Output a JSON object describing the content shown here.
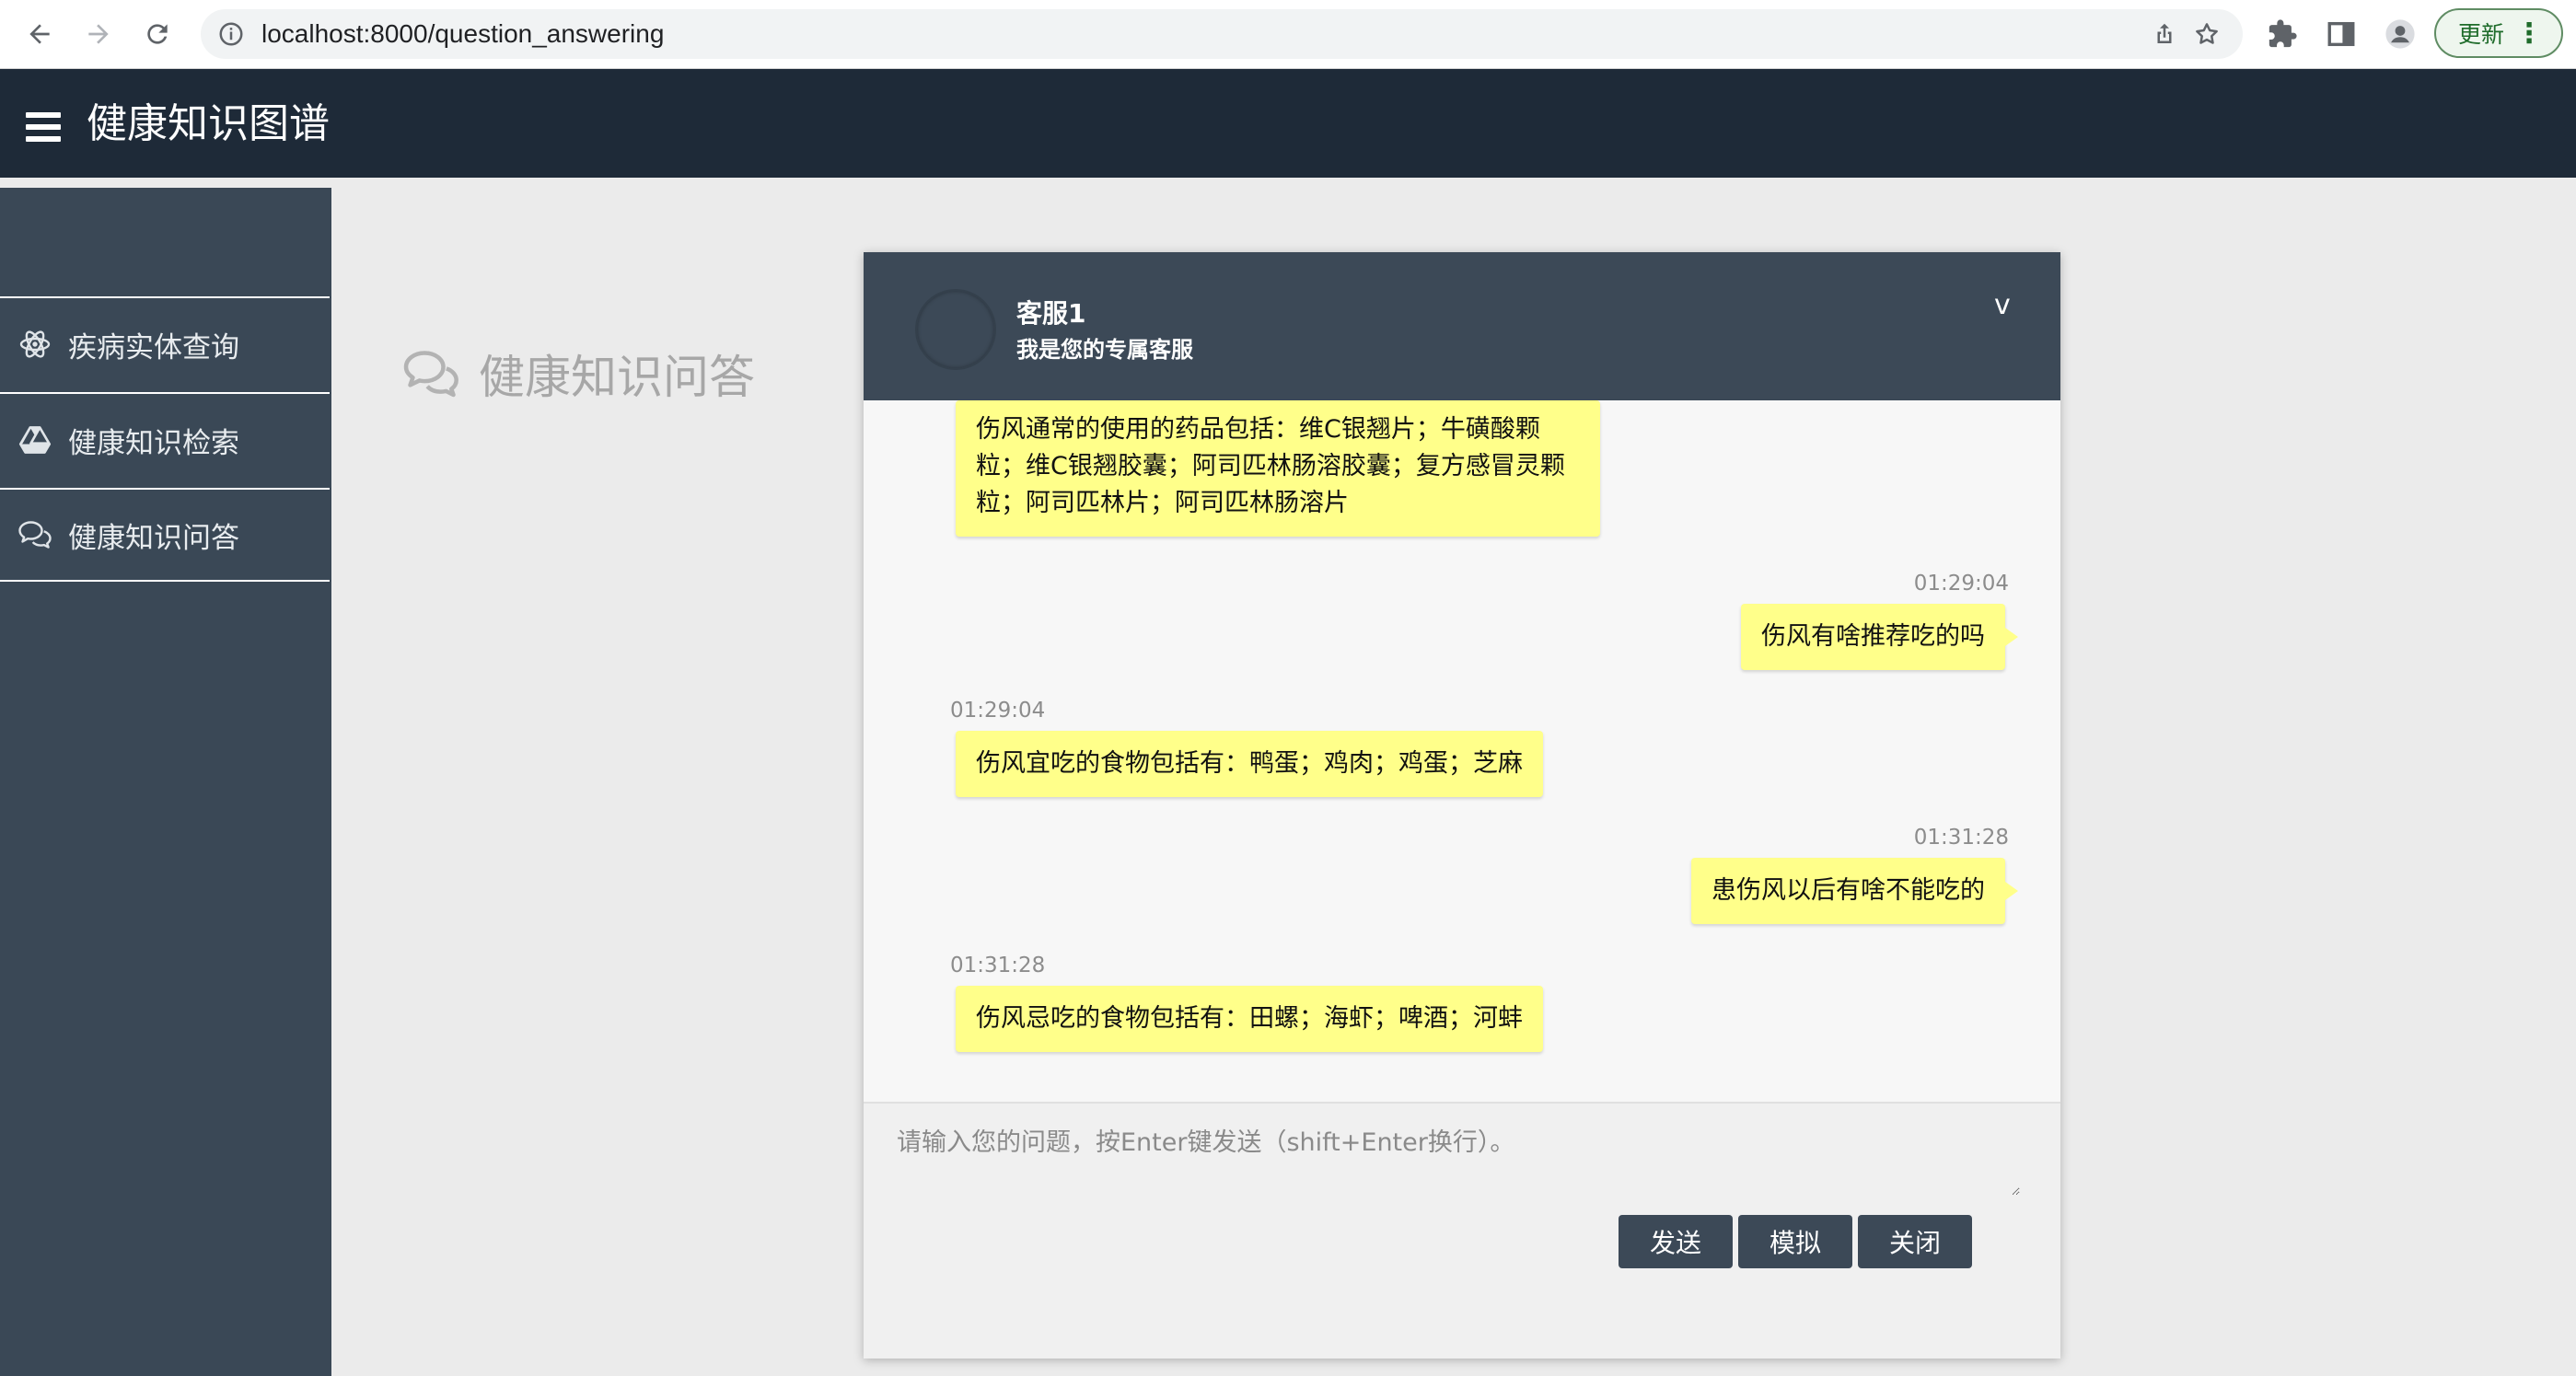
{
  "browser": {
    "url_host": "localhost:8000/question_answering",
    "update_label": "更新",
    "update_menu": "⋮"
  },
  "app": {
    "title": "健康知识图谱"
  },
  "sidebar": {
    "items": [
      {
        "label": "疾病实体查询",
        "icon": "atom-icon"
      },
      {
        "label": "健康知识检索",
        "icon": "drive-icon"
      },
      {
        "label": "健康知识问答",
        "icon": "chat-bubbles-icon"
      }
    ]
  },
  "page": {
    "heading": "健康知识问答"
  },
  "chat": {
    "agent_name": "客服1",
    "agent_subtitle": "我是您的专属客服",
    "collapse_label": "v",
    "messages": [
      {
        "from": "bot",
        "time": "",
        "text": "伤风通常的使用的药品包括：维C银翘片；牛磺酸颗粒；维C银翘胶囊；阿司匹林肠溶胶囊；复方感冒灵颗粒；阿司匹林片；阿司匹林肠溶片"
      },
      {
        "from": "user",
        "time": "01:29:04",
        "text": "伤风有啥推荐吃的吗"
      },
      {
        "from": "bot",
        "time": "01:29:04",
        "text": "伤风宜吃的食物包括有：鸭蛋；鸡肉；鸡蛋；芝麻"
      },
      {
        "from": "user",
        "time": "01:31:28",
        "text": "患伤风以后有啥不能吃的"
      },
      {
        "from": "bot",
        "time": "01:31:28",
        "text": "伤风忌吃的食物包括有：田螺；海虾；啤酒；河蚌"
      }
    ],
    "input_placeholder": "请输入您的问题，按Enter键发送（shift+Enter换行）。",
    "buttons": {
      "send": "发送",
      "simulate": "模拟",
      "close": "关闭"
    }
  },
  "colors": {
    "header_bg": "#1e2a38",
    "sidebar_bg": "#3a4856",
    "chat_header_bg": "#3c4957",
    "bubble_bg": "#ffff8a"
  }
}
